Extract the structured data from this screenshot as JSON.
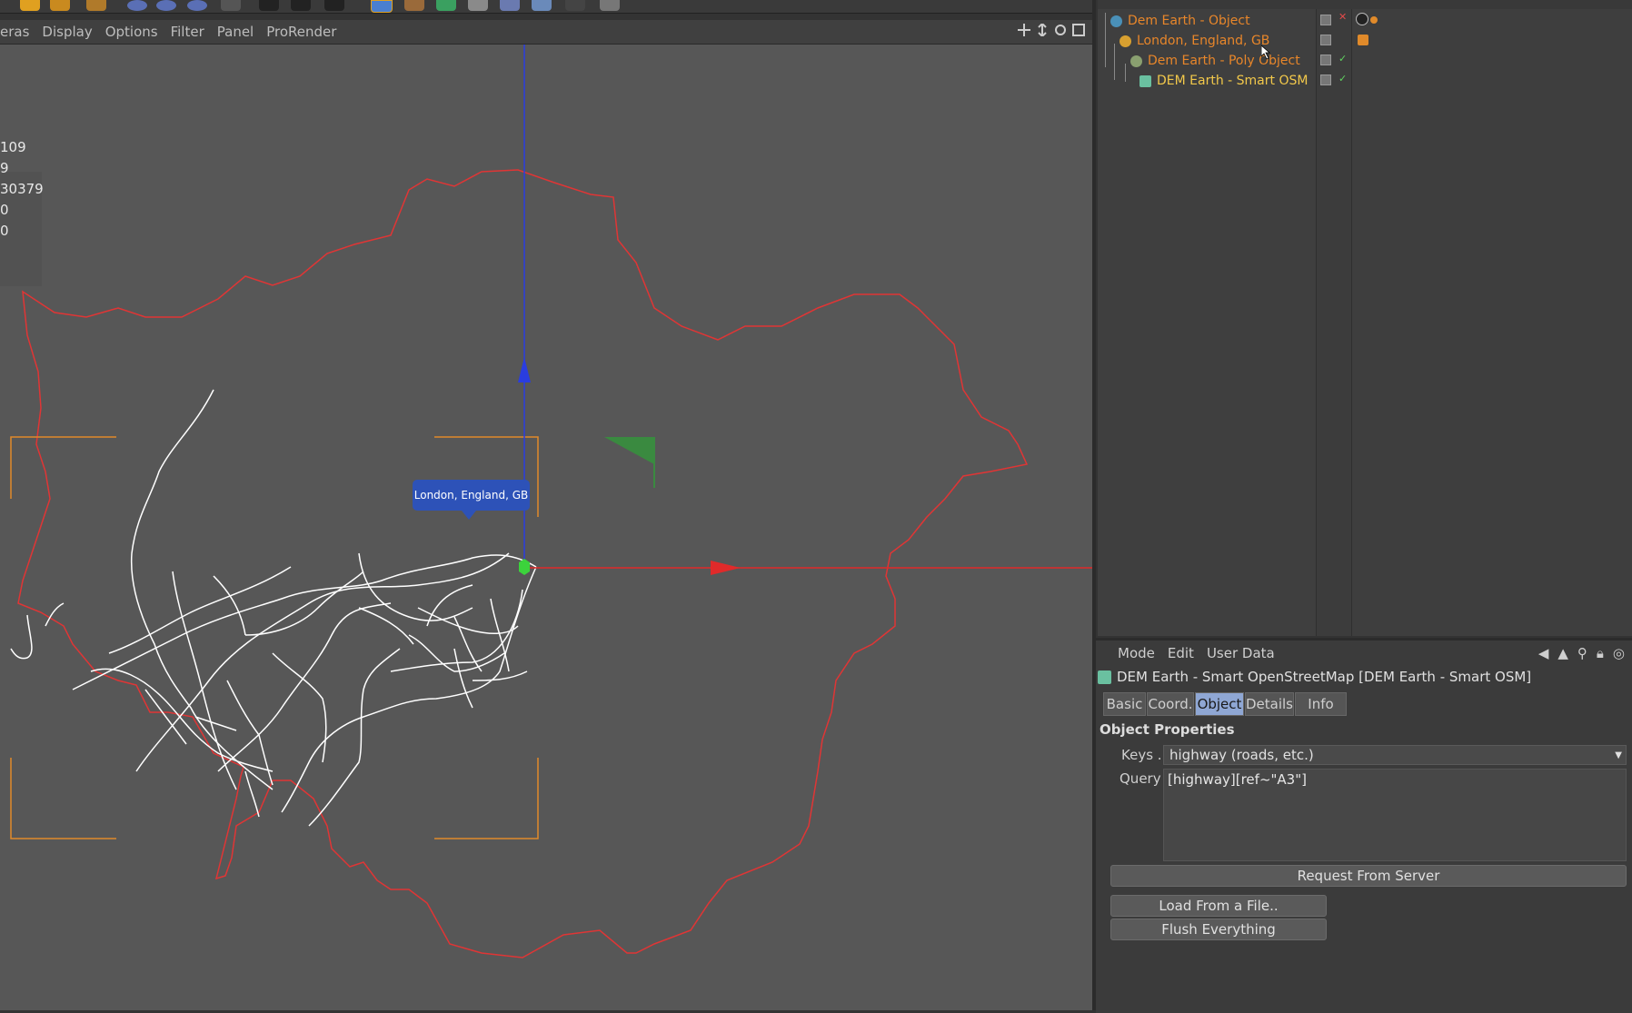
{
  "viewport": {
    "menu": [
      "eras",
      "Display",
      "Options",
      "Filter",
      "Panel",
      "ProRender"
    ],
    "stats": [
      "109",
      "9",
      "30379",
      "0",
      "0"
    ],
    "tooltip": "London, England, GB"
  },
  "object_manager": {
    "rows": [
      {
        "label": "Dem Earth - Object",
        "color": "orange"
      },
      {
        "label": "London, England, GB",
        "color": "orange"
      },
      {
        "label": "Dem Earth - Poly Object",
        "color": "orange"
      },
      {
        "label": "DEM Earth - Smart OSM",
        "color": "yellow"
      }
    ]
  },
  "attributes": {
    "menu": [
      "Mode",
      "Edit",
      "User Data"
    ],
    "title": "DEM Earth - Smart OpenStreetMap [DEM Earth - Smart OSM]",
    "tabs": [
      "Basic",
      "Coord.",
      "Object",
      "Details",
      "Info"
    ],
    "active_tab": "Object",
    "section": "Object Properties",
    "keys_label": "Keys . .",
    "keys_value": "highway  (roads, etc.)",
    "query_label": "Query",
    "query_value": "[highway][ref~\"A3\"]",
    "buttons": {
      "request": "Request From Server",
      "load": "Load From a File..",
      "flush": "Flush Everything"
    }
  },
  "colors": {
    "boundary": "#e03535",
    "roads": "#ffffff",
    "axis_x": "#e02a2a",
    "axis_y": "#2a3de0",
    "bbox": "#e08a2a",
    "tooltip_bg": "#2d52b8",
    "active_tab": "#8fa7d4"
  }
}
